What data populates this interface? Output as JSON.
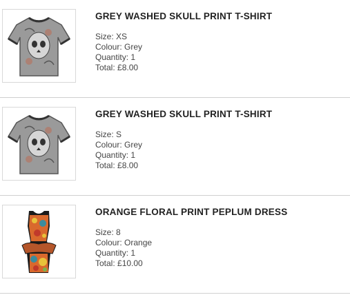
{
  "items": [
    {
      "name": "GREY WASHED SKULL PRINT T-SHIRT",
      "size_label": "Size:",
      "size": "XS",
      "colour_label": "Colour:",
      "colour": "Grey",
      "quantity_label": "Quantity:",
      "quantity": "1",
      "total_label": "Total:",
      "total": "£8.00",
      "image_icon": "grey-skull-tshirt-image"
    },
    {
      "name": "GREY WASHED SKULL PRINT T-SHIRT",
      "size_label": "Size:",
      "size": "S",
      "colour_label": "Colour:",
      "colour": "Grey",
      "quantity_label": "Quantity:",
      "quantity": "1",
      "total_label": "Total:",
      "total": "£8.00",
      "image_icon": "grey-skull-tshirt-image"
    },
    {
      "name": "ORANGE FLORAL PRINT PEPLUM DRESS",
      "size_label": "Size:",
      "size": "8",
      "colour_label": "Colour:",
      "colour": "Orange",
      "quantity_label": "Quantity:",
      "quantity": "1",
      "total_label": "Total:",
      "total": "£10.00",
      "image_icon": "orange-floral-dress-image"
    }
  ],
  "colors": {
    "separator": "#cfcfcf",
    "text": "#444444",
    "title": "#222222"
  }
}
